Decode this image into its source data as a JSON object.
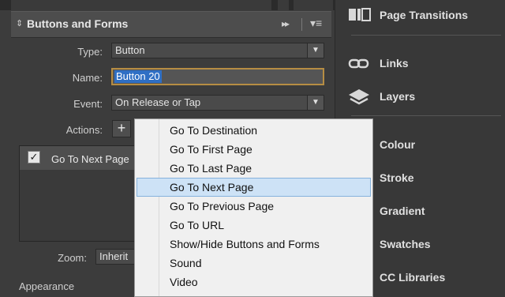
{
  "panel": {
    "title": "Buttons and Forms",
    "grip_icon": "⇕",
    "fast_forward_icon": "▸▸",
    "menu_icon": "▾≡"
  },
  "form": {
    "type_label": "Type:",
    "type_value": "Button",
    "name_label": "Name:",
    "name_value": "Button 20",
    "event_label": "Event:",
    "event_value": "On Release or Tap",
    "actions_label": "Actions:",
    "add_action_icon": "+",
    "zoom_label": "Zoom:",
    "zoom_value": "Inherit",
    "appearance_label": "Appearance",
    "dropdown_arrow": "▼"
  },
  "actions_list": [
    {
      "label": "Go To Next Page",
      "checked": true,
      "check_glyph": "✓"
    }
  ],
  "popup_menu": {
    "items": [
      "Go To Destination",
      "Go To First Page",
      "Go To Last Page",
      "Go To Next Page",
      "Go To Previous Page",
      "Go To URL",
      "Show/Hide Buttons and Forms",
      "Sound",
      "Video"
    ],
    "highlighted": "Go To Next Page"
  },
  "right_panel": {
    "items": [
      {
        "label": "Page Transitions",
        "icon": "page-transitions-icon"
      },
      {
        "label": "Links",
        "icon": "links-icon"
      },
      {
        "label": "Layers",
        "icon": "layers-icon"
      },
      {
        "label": "Colour",
        "icon": "colour-icon"
      },
      {
        "label": "Stroke",
        "icon": "stroke-icon"
      },
      {
        "label": "Gradient",
        "icon": "gradient-icon"
      },
      {
        "label": "Swatches",
        "icon": "swatches-icon"
      },
      {
        "label": "CC Libraries",
        "icon": "cc-libraries-icon"
      }
    ]
  },
  "colors": {
    "panel_bg": "#3c3c3c",
    "selection": "#2f6fc4",
    "field_focus": "#b68d43",
    "menu_highlight": "#cde2f6"
  }
}
